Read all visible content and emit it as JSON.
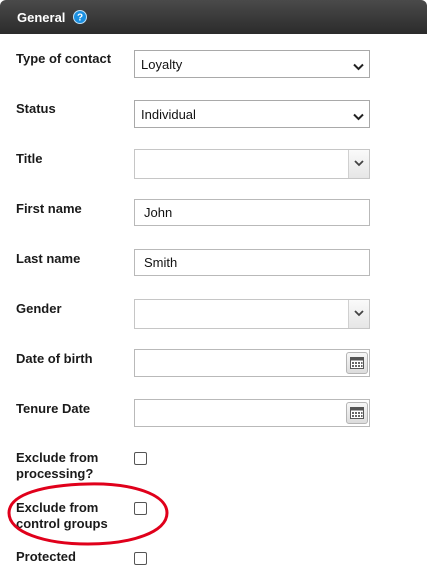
{
  "panel": {
    "title": "General",
    "help_icon": "help-icon"
  },
  "fields": {
    "type_of_contact": {
      "label": "Type of contact",
      "value": "Loyalty"
    },
    "status": {
      "label": "Status",
      "value": "Individual"
    },
    "title": {
      "label": "Title",
      "value": ""
    },
    "first_name": {
      "label": "First name",
      "value": "John"
    },
    "last_name": {
      "label": "Last name",
      "value": "Smith"
    },
    "gender": {
      "label": "Gender",
      "value": ""
    },
    "date_of_birth": {
      "label": "Date of birth",
      "value": "",
      "icon": "calendar-icon"
    },
    "tenure_date": {
      "label": "Tenure Date",
      "value": "",
      "icon": "calendar-icon"
    },
    "exclude_processing": {
      "label_line1": "Exclude from",
      "label_line2": "processing?",
      "checked": false
    },
    "exclude_control": {
      "label_line1": "Exclude from",
      "label_line2": "control groups",
      "checked": false
    },
    "protected": {
      "label": "Protected",
      "checked": false
    }
  },
  "colors": {
    "header_bg": "#333333",
    "help_icon": "#1a8fe0",
    "annotation": "#e0001b"
  }
}
